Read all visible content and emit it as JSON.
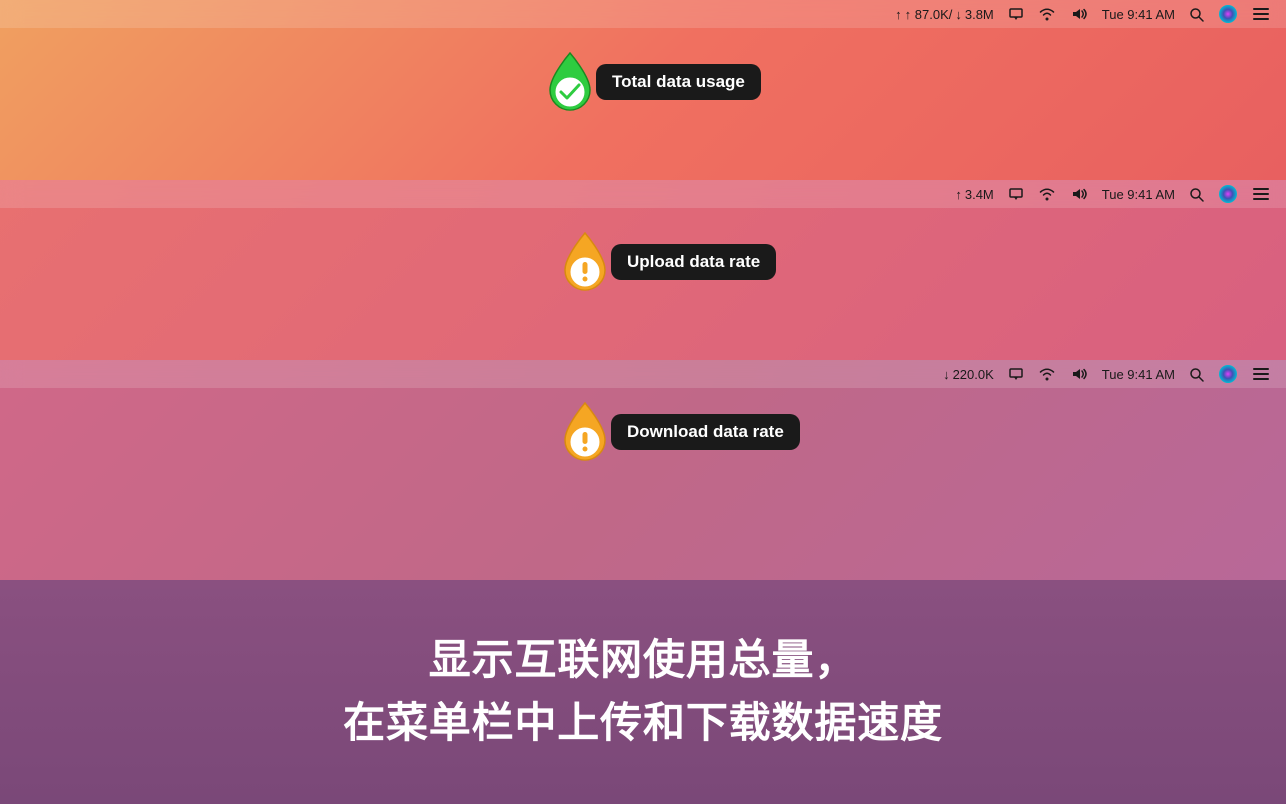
{
  "panels": [
    {
      "id": "panel-1",
      "menubar": {
        "upload": "87.0K/",
        "download": "3.8M",
        "time": "Tue 9:41 AM"
      },
      "tooltip": {
        "label": "Total data usage"
      },
      "icon_type": "green"
    },
    {
      "id": "panel-2",
      "menubar": {
        "upload": "3.4M",
        "time": "Tue 9:41 AM"
      },
      "tooltip": {
        "label": "Upload data rate"
      },
      "icon_type": "orange"
    },
    {
      "id": "panel-3",
      "menubar": {
        "download": "220.0K",
        "time": "Tue 9:41 AM"
      },
      "tooltip": {
        "label": "Download data rate"
      },
      "icon_type": "orange"
    }
  ],
  "bottom": {
    "line1": "显示互联网使用总量，",
    "line2": "在菜单栏中上传和下载数据速度"
  },
  "menubar": {
    "upload_label": "↑ 87.0K/",
    "download_label": "↓ 3.8M",
    "upload_only_label": "↑ 3.4M",
    "download_only_label": "↓ 220.0K",
    "time": "Tue 9:41 AM"
  }
}
